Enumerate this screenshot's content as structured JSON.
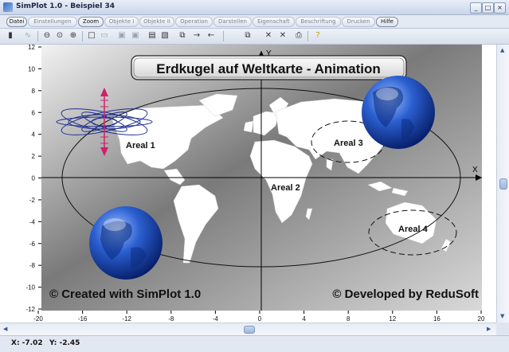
{
  "window": {
    "title": "SimPlot 1.0 - Beispiel 34"
  },
  "menu": [
    {
      "label": "Datei",
      "active": true
    },
    {
      "label": "Einstellungen",
      "active": false
    },
    {
      "label": "Zoom",
      "active": true
    },
    {
      "label": "Objekte I",
      "active": false
    },
    {
      "label": "Objekte II",
      "active": false
    },
    {
      "label": "Operation",
      "active": false
    },
    {
      "label": "Darstellen",
      "active": false
    },
    {
      "label": "Eigenschaft",
      "active": false
    },
    {
      "label": "Beschriftung",
      "active": false
    },
    {
      "label": "Drucken",
      "active": false
    },
    {
      "label": "Hilfe",
      "active": true
    }
  ],
  "plot": {
    "title": "Erdkugel auf Weltkarte - Animation",
    "x_axis_label": "X",
    "y_axis_label": "Y",
    "x_ticks": [
      "-20",
      "-16",
      "-12",
      "-8",
      "-4",
      "0",
      "4",
      "8",
      "12",
      "16",
      "20"
    ],
    "y_ticks": [
      "12",
      "10",
      "8",
      "6",
      "4",
      "2",
      "0",
      "-2",
      "-4",
      "-6",
      "-8",
      "-10",
      "-12"
    ],
    "areas": [
      "Areal 1",
      "Areal 2",
      "Areal 3",
      "Areal 4"
    ],
    "footer_left": "© Created with SimPlot 1.0",
    "footer_right": "© Developed by ReduSoft"
  },
  "status": {
    "x": "X:  -7.02",
    "y": "Y:  -2.45"
  },
  "colors": {
    "globe": "#1f4fb0",
    "map_bg": "#8a8a8a",
    "marker": "#d0206a",
    "flower": "#1f2f8f"
  }
}
